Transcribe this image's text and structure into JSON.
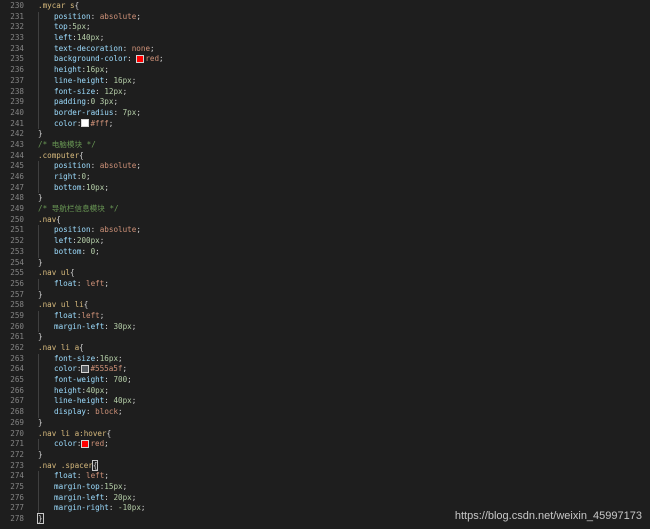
{
  "colors": {
    "background": "#1e1e1e",
    "line_number": "#858585",
    "selector": "#d7ba7d",
    "property": "#9cdcfe",
    "value": "#ce9178",
    "comment": "#6a9955",
    "swatch_red": "#ff0000",
    "swatch_white": "#ffffff",
    "swatch_gray": "#555a5f"
  },
  "lines": [
    {
      "n": "230",
      "indent": 0,
      "toks": [
        [
          "sel",
          ".mycar s"
        ],
        [
          "pun",
          "{"
        ]
      ]
    },
    {
      "n": "231",
      "indent": 1,
      "toks": [
        [
          "prop",
          "position"
        ],
        [
          "pun",
          ": "
        ],
        [
          "val",
          "absolute"
        ],
        [
          "pun",
          ";"
        ]
      ]
    },
    {
      "n": "232",
      "indent": 1,
      "toks": [
        [
          "prop",
          "top"
        ],
        [
          "pun",
          ":"
        ],
        [
          "num",
          "5px"
        ],
        [
          "pun",
          ";"
        ]
      ]
    },
    {
      "n": "233",
      "indent": 1,
      "toks": [
        [
          "prop",
          "left"
        ],
        [
          "pun",
          ":"
        ],
        [
          "num",
          "140px"
        ],
        [
          "pun",
          ";"
        ]
      ]
    },
    {
      "n": "234",
      "indent": 1,
      "toks": [
        [
          "prop",
          "text-decoration"
        ],
        [
          "pun",
          ": "
        ],
        [
          "val",
          "none"
        ],
        [
          "pun",
          ";"
        ]
      ]
    },
    {
      "n": "235",
      "indent": 1,
      "toks": [
        [
          "prop",
          "background-color"
        ],
        [
          "pun",
          ": "
        ],
        [
          "sw",
          "#ff0000"
        ],
        [
          "val",
          "red"
        ],
        [
          "pun",
          ";"
        ]
      ]
    },
    {
      "n": "236",
      "indent": 1,
      "toks": [
        [
          "prop",
          "height"
        ],
        [
          "pun",
          ":"
        ],
        [
          "num",
          "16px"
        ],
        [
          "pun",
          ";"
        ]
      ]
    },
    {
      "n": "237",
      "indent": 1,
      "toks": [
        [
          "prop",
          "line-height"
        ],
        [
          "pun",
          ": "
        ],
        [
          "num",
          "16px"
        ],
        [
          "pun",
          ";"
        ]
      ]
    },
    {
      "n": "238",
      "indent": 1,
      "toks": [
        [
          "prop",
          "font-size"
        ],
        [
          "pun",
          ": "
        ],
        [
          "num",
          "12px"
        ],
        [
          "pun",
          ";"
        ]
      ]
    },
    {
      "n": "239",
      "indent": 1,
      "toks": [
        [
          "prop",
          "padding"
        ],
        [
          "pun",
          ":"
        ],
        [
          "num",
          "0 3px"
        ],
        [
          "pun",
          ";"
        ]
      ]
    },
    {
      "n": "240",
      "indent": 1,
      "toks": [
        [
          "prop",
          "border-radius"
        ],
        [
          "pun",
          ": "
        ],
        [
          "num",
          "7px"
        ],
        [
          "pun",
          ";"
        ]
      ]
    },
    {
      "n": "241",
      "indent": 1,
      "toks": [
        [
          "prop",
          "color"
        ],
        [
          "pun",
          ":"
        ],
        [
          "sw",
          "#ffffff"
        ],
        [
          "val",
          "#fff"
        ],
        [
          "pun",
          ";"
        ]
      ]
    },
    {
      "n": "242",
      "indent": 0,
      "toks": [
        [
          "pun",
          "}"
        ]
      ]
    },
    {
      "n": "243",
      "indent": 0,
      "toks": [
        [
          "cmt",
          "/* 电脑模块 */"
        ]
      ]
    },
    {
      "n": "244",
      "indent": 0,
      "toks": [
        [
          "sel",
          ".computer"
        ],
        [
          "pun",
          "{"
        ]
      ]
    },
    {
      "n": "245",
      "indent": 1,
      "toks": [
        [
          "prop",
          "position"
        ],
        [
          "pun",
          ": "
        ],
        [
          "val",
          "absolute"
        ],
        [
          "pun",
          ";"
        ]
      ]
    },
    {
      "n": "246",
      "indent": 1,
      "toks": [
        [
          "prop",
          "right"
        ],
        [
          "pun",
          ":"
        ],
        [
          "num",
          "0"
        ],
        [
          "pun",
          ";"
        ]
      ]
    },
    {
      "n": "247",
      "indent": 1,
      "toks": [
        [
          "prop",
          "bottom"
        ],
        [
          "pun",
          ":"
        ],
        [
          "num",
          "10px"
        ],
        [
          "pun",
          ";"
        ]
      ]
    },
    {
      "n": "248",
      "indent": 0,
      "toks": [
        [
          "pun",
          "}"
        ]
      ]
    },
    {
      "n": "249",
      "indent": 0,
      "toks": [
        [
          "cmt",
          "/* 导航栏信息模块 */"
        ]
      ]
    },
    {
      "n": "250",
      "indent": 0,
      "toks": [
        [
          "sel",
          ".nav"
        ],
        [
          "pun",
          "{"
        ]
      ]
    },
    {
      "n": "251",
      "indent": 1,
      "toks": [
        [
          "prop",
          "position"
        ],
        [
          "pun",
          ": "
        ],
        [
          "val",
          "absolute"
        ],
        [
          "pun",
          ";"
        ]
      ]
    },
    {
      "n": "252",
      "indent": 1,
      "toks": [
        [
          "prop",
          "left"
        ],
        [
          "pun",
          ":"
        ],
        [
          "num",
          "200px"
        ],
        [
          "pun",
          ";"
        ]
      ]
    },
    {
      "n": "253",
      "indent": 1,
      "toks": [
        [
          "prop",
          "bottom"
        ],
        [
          "pun",
          ": "
        ],
        [
          "num",
          "0"
        ],
        [
          "pun",
          ";"
        ]
      ]
    },
    {
      "n": "254",
      "indent": 0,
      "toks": [
        [
          "pun",
          "}"
        ]
      ]
    },
    {
      "n": "255",
      "indent": 0,
      "toks": [
        [
          "sel",
          ".nav ul"
        ],
        [
          "pun",
          "{"
        ]
      ]
    },
    {
      "n": "256",
      "indent": 1,
      "toks": [
        [
          "prop",
          "float"
        ],
        [
          "pun",
          ": "
        ],
        [
          "val",
          "left"
        ],
        [
          "pun",
          ";"
        ]
      ]
    },
    {
      "n": "257",
      "indent": 0,
      "toks": [
        [
          "pun",
          "}"
        ]
      ]
    },
    {
      "n": "258",
      "indent": 0,
      "toks": [
        [
          "sel",
          ".nav ul li"
        ],
        [
          "pun",
          "{"
        ]
      ]
    },
    {
      "n": "259",
      "indent": 1,
      "toks": [
        [
          "prop",
          "float"
        ],
        [
          "pun",
          ":"
        ],
        [
          "val",
          "left"
        ],
        [
          "pun",
          ";"
        ]
      ]
    },
    {
      "n": "260",
      "indent": 1,
      "toks": [
        [
          "prop",
          "margin-left"
        ],
        [
          "pun",
          ": "
        ],
        [
          "num",
          "30px"
        ],
        [
          "pun",
          ";"
        ]
      ]
    },
    {
      "n": "261",
      "indent": 0,
      "toks": [
        [
          "pun",
          "}"
        ]
      ]
    },
    {
      "n": "262",
      "indent": 0,
      "toks": [
        [
          "sel",
          ".nav li a"
        ],
        [
          "pun",
          "{"
        ]
      ]
    },
    {
      "n": "263",
      "indent": 1,
      "toks": [
        [
          "prop",
          "font-size"
        ],
        [
          "pun",
          ":"
        ],
        [
          "num",
          "16px"
        ],
        [
          "pun",
          ";"
        ]
      ]
    },
    {
      "n": "264",
      "indent": 1,
      "toks": [
        [
          "prop",
          "color"
        ],
        [
          "pun",
          ":"
        ],
        [
          "sw",
          "#555a5f"
        ],
        [
          "val",
          "#555a5f"
        ],
        [
          "pun",
          ";"
        ]
      ]
    },
    {
      "n": "265",
      "indent": 1,
      "toks": [
        [
          "prop",
          "font-weight"
        ],
        [
          "pun",
          ": "
        ],
        [
          "num",
          "700"
        ],
        [
          "pun",
          ";"
        ]
      ]
    },
    {
      "n": "266",
      "indent": 1,
      "toks": [
        [
          "prop",
          "height"
        ],
        [
          "pun",
          ":"
        ],
        [
          "num",
          "40px"
        ],
        [
          "pun",
          ";"
        ]
      ]
    },
    {
      "n": "267",
      "indent": 1,
      "toks": [
        [
          "prop",
          "line-height"
        ],
        [
          "pun",
          ": "
        ],
        [
          "num",
          "40px"
        ],
        [
          "pun",
          ";"
        ]
      ]
    },
    {
      "n": "268",
      "indent": 1,
      "toks": [
        [
          "prop",
          "display"
        ],
        [
          "pun",
          ": "
        ],
        [
          "val",
          "block"
        ],
        [
          "pun",
          ";"
        ]
      ]
    },
    {
      "n": "269",
      "indent": 0,
      "toks": [
        [
          "pun",
          "}"
        ]
      ]
    },
    {
      "n": "270",
      "indent": 0,
      "toks": [
        [
          "sel",
          ".nav li a:hover"
        ],
        [
          "pun",
          "{"
        ]
      ]
    },
    {
      "n": "271",
      "indent": 1,
      "toks": [
        [
          "prop",
          "color"
        ],
        [
          "pun",
          ":"
        ],
        [
          "sw",
          "#ff0000"
        ],
        [
          "val",
          "red"
        ],
        [
          "pun",
          ";"
        ]
      ]
    },
    {
      "n": "272",
      "indent": 0,
      "toks": [
        [
          "pun",
          "}"
        ]
      ]
    },
    {
      "n": "273",
      "indent": 0,
      "toks": [
        [
          "sel",
          ".nav .spacer"
        ],
        [
          "cur",
          "{"
        ]
      ]
    },
    {
      "n": "274",
      "indent": 1,
      "toks": [
        [
          "prop",
          "float"
        ],
        [
          "pun",
          ": "
        ],
        [
          "val",
          "left"
        ],
        [
          "pun",
          ";"
        ]
      ]
    },
    {
      "n": "275",
      "indent": 1,
      "toks": [
        [
          "prop",
          "margin-top"
        ],
        [
          "pun",
          ":"
        ],
        [
          "num",
          "15px"
        ],
        [
          "pun",
          ";"
        ]
      ]
    },
    {
      "n": "276",
      "indent": 1,
      "toks": [
        [
          "prop",
          "margin-left"
        ],
        [
          "pun",
          ": "
        ],
        [
          "num",
          "20px"
        ],
        [
          "pun",
          ";"
        ]
      ]
    },
    {
      "n": "277",
      "indent": 1,
      "toks": [
        [
          "prop",
          "margin-right"
        ],
        [
          "pun",
          ": "
        ],
        [
          "num",
          "-10px"
        ],
        [
          "pun",
          ";"
        ]
      ]
    },
    {
      "n": "278",
      "indent": 0,
      "toks": [
        [
          "cur",
          "}"
        ]
      ]
    }
  ],
  "watermark": "https://blog.csdn.net/weixin_45997173"
}
